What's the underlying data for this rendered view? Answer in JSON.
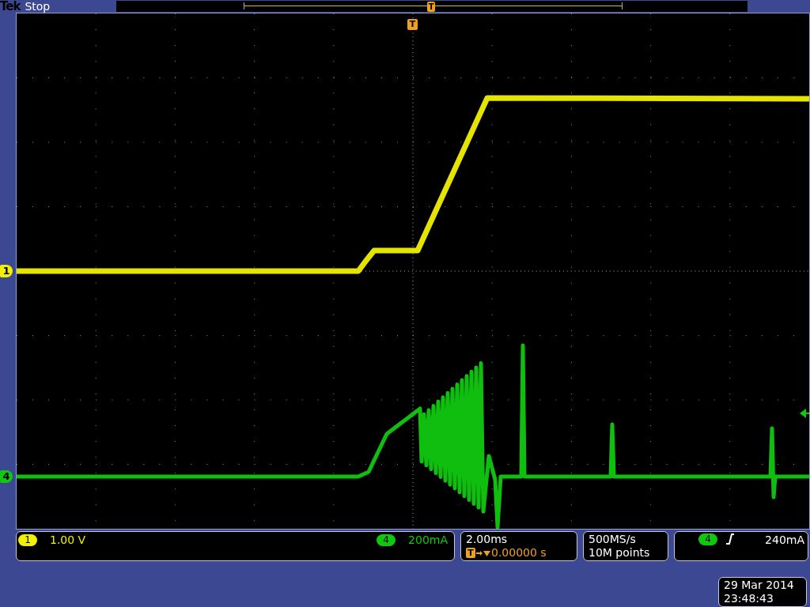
{
  "status_bar": {
    "brand": "Tek",
    "state": "Stop"
  },
  "record_view": {
    "trigger_label": "T"
  },
  "trigger_marker": {
    "label": "T"
  },
  "channels": [
    {
      "number": "1",
      "color": "#f0f000",
      "marker": "1",
      "scale": "1.00 V"
    },
    {
      "number": "4",
      "color": "#10c810",
      "marker": "4",
      "scale": "200mA"
    }
  ],
  "timebase": {
    "scale": "2.00ms",
    "trigger_label": "T",
    "position": "0.00000 s"
  },
  "acquisition": {
    "sample_rate": "500MS/s",
    "record_length": "10M points"
  },
  "trigger": {
    "source": "4",
    "level": "240mA"
  },
  "clock": {
    "date": "29 Mar 2014",
    "time": "23:48:43"
  }
}
